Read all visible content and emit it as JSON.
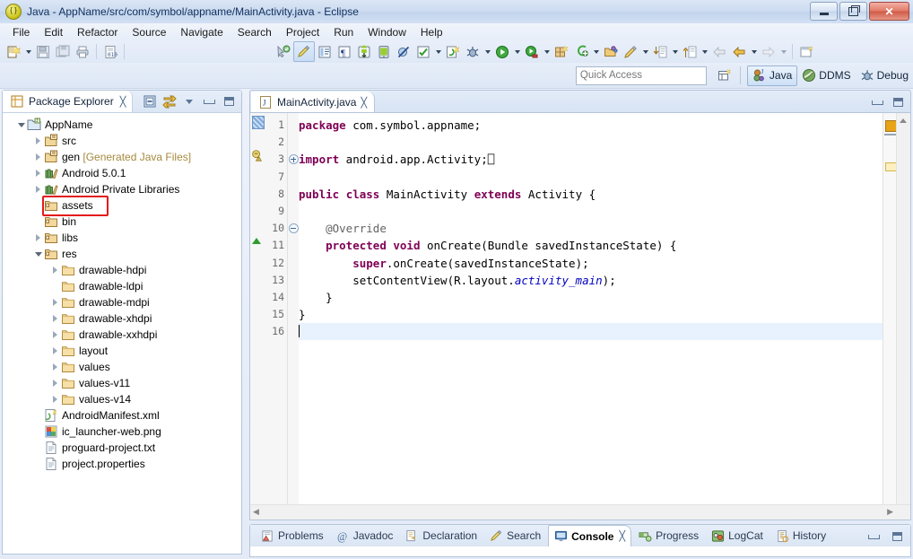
{
  "window": {
    "title": "Java - AppName/src/com/symbol/appname/MainActivity.java - Eclipse",
    "app_icon": "eclipse-icon",
    "buttons": {
      "minimize": "minimize-button",
      "maximize": "maximize-button",
      "close": "close-button"
    }
  },
  "menu": {
    "items": [
      "File",
      "Edit",
      "Refactor",
      "Source",
      "Navigate",
      "Search",
      "Project",
      "Run",
      "Window",
      "Help"
    ]
  },
  "toolbar": {
    "groups": [
      {
        "items": [
          {
            "name": "new-wizard-icon",
            "arrow": true
          },
          {
            "name": "save-icon",
            "arrow": false
          },
          {
            "name": "save-all-icon",
            "arrow": false
          },
          {
            "name": "print-icon",
            "arrow": false
          }
        ]
      },
      {
        "items": [
          {
            "name": "new-java-class-icon",
            "arrow": false
          }
        ]
      },
      {
        "items": [
          {
            "name": "open-type-icon",
            "arrow": false
          },
          {
            "name": "toggle-markoccurrences-icon",
            "arrow": false,
            "pressed": true
          },
          {
            "name": "show-whitespace-icon",
            "arrow": false
          },
          {
            "name": "pilcrow-icon",
            "arrow": false
          },
          {
            "name": "android-sdk-manager-icon",
            "arrow": false
          },
          {
            "name": "android-avd-manager-icon",
            "arrow": false
          },
          {
            "name": "skip-breakpoints-icon",
            "arrow": false
          },
          {
            "name": "run-checks-icon",
            "arrow": true
          },
          {
            "name": "new-android-project-icon",
            "arrow": false
          },
          {
            "name": "debug-icon",
            "arrow": true
          },
          {
            "name": "run-icon",
            "arrow": true
          },
          {
            "name": "external-tools-icon",
            "arrow": true
          },
          {
            "name": "new-window-icon",
            "arrow": false
          },
          {
            "name": "new-package-icon",
            "arrow": true
          },
          {
            "name": "open-resource-icon",
            "arrow": false
          },
          {
            "name": "annotation-icon",
            "arrow": true
          },
          {
            "name": "next-annotation-icon",
            "arrow": true
          },
          {
            "name": "previous-edit-icon",
            "arrow": false
          },
          {
            "name": "back-icon",
            "arrow": true
          },
          {
            "name": "forward-icon",
            "arrow": true
          }
        ]
      },
      {
        "items": [
          {
            "name": "open-perspective-icon",
            "arrow": false
          }
        ]
      }
    ]
  },
  "quick_access": {
    "placeholder": "Quick Access",
    "value": "",
    "new_perspective_icon": "new-perspective-icon",
    "perspectives": [
      {
        "label": "Java",
        "icon": "java-perspective-icon",
        "active": true
      },
      {
        "label": "DDMS",
        "icon": "ddms-perspective-icon",
        "active": false
      },
      {
        "label": "Debug",
        "icon": "debug-perspective-icon",
        "active": false
      }
    ]
  },
  "package_explorer": {
    "tab_label": "Package Explorer",
    "tab_icon": "package-explorer-icon",
    "close_glyph": "╳",
    "toolbar": [
      {
        "name": "collapse-all-icon"
      },
      {
        "name": "link-with-editor-icon"
      },
      {
        "name": "view-menu-icon"
      },
      {
        "name": "minimize-view-icon"
      },
      {
        "name": "maximize-view-icon"
      }
    ],
    "tree": [
      {
        "label": "AppName",
        "suffix": "",
        "depth": 0,
        "twist": "expanded",
        "icon": "java-project-icon",
        "highlight": false
      },
      {
        "label": "src",
        "suffix": "",
        "depth": 1,
        "twist": "collapsed",
        "icon": "source-folder-icon",
        "highlight": false
      },
      {
        "label": "gen",
        "suffix": " [Generated Java Files]",
        "depth": 1,
        "twist": "collapsed",
        "icon": "source-folder-icon",
        "highlight": false
      },
      {
        "label": "Android 5.0.1",
        "suffix": "",
        "depth": 1,
        "twist": "collapsed",
        "icon": "library-icon",
        "highlight": false
      },
      {
        "label": "Android Private Libraries",
        "suffix": "",
        "depth": 1,
        "twist": "collapsed",
        "icon": "library-icon",
        "highlight": false
      },
      {
        "label": "assets",
        "suffix": "",
        "depth": 1,
        "twist": "none",
        "icon": "folder-res-icon",
        "highlight": true
      },
      {
        "label": "bin",
        "suffix": "",
        "depth": 1,
        "twist": "none",
        "icon": "folder-res-icon",
        "highlight": false
      },
      {
        "label": "libs",
        "suffix": "",
        "depth": 1,
        "twist": "collapsed",
        "icon": "folder-res-icon",
        "highlight": false
      },
      {
        "label": "res",
        "suffix": "",
        "depth": 1,
        "twist": "expanded",
        "icon": "folder-res-icon",
        "highlight": false
      },
      {
        "label": "drawable-hdpi",
        "suffix": "",
        "depth": 2,
        "twist": "collapsed",
        "icon": "folder-icon",
        "highlight": false
      },
      {
        "label": "drawable-ldpi",
        "suffix": "",
        "depth": 2,
        "twist": "none",
        "icon": "folder-icon",
        "highlight": false
      },
      {
        "label": "drawable-mdpi",
        "suffix": "",
        "depth": 2,
        "twist": "collapsed",
        "icon": "folder-icon",
        "highlight": false
      },
      {
        "label": "drawable-xhdpi",
        "suffix": "",
        "depth": 2,
        "twist": "collapsed",
        "icon": "folder-icon",
        "highlight": false
      },
      {
        "label": "drawable-xxhdpi",
        "suffix": "",
        "depth": 2,
        "twist": "collapsed",
        "icon": "folder-icon",
        "highlight": false
      },
      {
        "label": "layout",
        "suffix": "",
        "depth": 2,
        "twist": "collapsed",
        "icon": "folder-icon",
        "highlight": false
      },
      {
        "label": "values",
        "suffix": "",
        "depth": 2,
        "twist": "collapsed",
        "icon": "folder-icon",
        "highlight": false
      },
      {
        "label": "values-v11",
        "suffix": "",
        "depth": 2,
        "twist": "collapsed",
        "icon": "folder-icon",
        "highlight": false
      },
      {
        "label": "values-v14",
        "suffix": "",
        "depth": 2,
        "twist": "collapsed",
        "icon": "folder-icon",
        "highlight": false
      },
      {
        "label": "AndroidManifest.xml",
        "suffix": "",
        "depth": 1,
        "twist": "none",
        "icon": "android-xml-icon",
        "highlight": false
      },
      {
        "label": "ic_launcher-web.png",
        "suffix": "",
        "depth": 1,
        "twist": "none",
        "icon": "image-file-icon",
        "highlight": false
      },
      {
        "label": "proguard-project.txt",
        "suffix": "",
        "depth": 1,
        "twist": "none",
        "icon": "text-file-icon",
        "highlight": false
      },
      {
        "label": "project.properties",
        "suffix": "",
        "depth": 1,
        "twist": "none",
        "icon": "text-file-icon",
        "highlight": false
      }
    ]
  },
  "editor": {
    "tab_label": "MainActivity.java",
    "tab_icon": "java-file-icon",
    "close_glyph": "╳",
    "tools": [
      {
        "name": "minimize-editor-icon"
      },
      {
        "name": "maximize-editor-icon"
      }
    ],
    "lines": [
      {
        "no": "1",
        "html": "<span class=\"kw\">package</span> com.symbol.appname;",
        "fold": "",
        "marker": "changed",
        "cursor": false
      },
      {
        "no": "2",
        "html": "",
        "fold": "",
        "marker": "",
        "cursor": false
      },
      {
        "no": "3",
        "html": "<span class=\"kw\">import</span> android.app.Activity;⎕",
        "fold": "plus",
        "marker": "warning",
        "cursor": false
      },
      {
        "no": "7",
        "html": "",
        "fold": "",
        "marker": "",
        "cursor": false
      },
      {
        "no": "8",
        "html": "<span class=\"kw\">public</span> <span class=\"kw\">class</span> MainActivity <span class=\"kw\">extends</span> Activity {",
        "fold": "",
        "marker": "",
        "cursor": false
      },
      {
        "no": "9",
        "html": "",
        "fold": "",
        "marker": "",
        "cursor": false
      },
      {
        "no": "10",
        "html": "    <span class=\"ann\">@Override</span>",
        "fold": "minus",
        "marker": "",
        "cursor": false
      },
      {
        "no": "11",
        "html": "    <span class=\"kw\">protected</span> <span class=\"kw\">void</span> onCreate(Bundle savedInstanceState) {",
        "fold": "",
        "marker": "override",
        "cursor": false
      },
      {
        "no": "12",
        "html": "        <span class=\"kw\">super</span>.onCreate(savedInstanceState);",
        "fold": "",
        "marker": "",
        "cursor": false
      },
      {
        "no": "13",
        "html": "        setContentView(R.layout.<span class=\"fld\">activity_main</span>);",
        "fold": "",
        "marker": "",
        "cursor": false
      },
      {
        "no": "14",
        "html": "    }",
        "fold": "",
        "marker": "",
        "cursor": false
      },
      {
        "no": "15",
        "html": "}",
        "fold": "",
        "marker": "",
        "cursor": false
      },
      {
        "no": "16",
        "html": "<span class=\"caret\"></span>",
        "fold": "",
        "marker": "",
        "cursor": true
      }
    ]
  },
  "console_panel": {
    "tabs": [
      {
        "label": "Problems",
        "icon": "problems-icon",
        "active": false
      },
      {
        "label": "Javadoc",
        "icon": "javadoc-icon",
        "active": false
      },
      {
        "label": "Declaration",
        "icon": "declaration-icon",
        "active": false
      },
      {
        "label": "Search",
        "icon": "search-icon",
        "active": false
      },
      {
        "label": "Console",
        "icon": "console-icon",
        "active": true,
        "close_glyph": "╳"
      },
      {
        "label": "Progress",
        "icon": "progress-icon",
        "active": false
      },
      {
        "label": "LogCat",
        "icon": "logcat-icon",
        "active": false
      },
      {
        "label": "History",
        "icon": "history-icon",
        "active": false
      }
    ],
    "tools": [
      {
        "name": "minimize-console-icon"
      },
      {
        "name": "maximize-console-icon"
      }
    ]
  },
  "colors": {
    "highlight_red": "#e21b1b",
    "keyword_purple": "#7f0055",
    "field_blue": "#0000c0",
    "accent_blue": "#3b5a84"
  }
}
